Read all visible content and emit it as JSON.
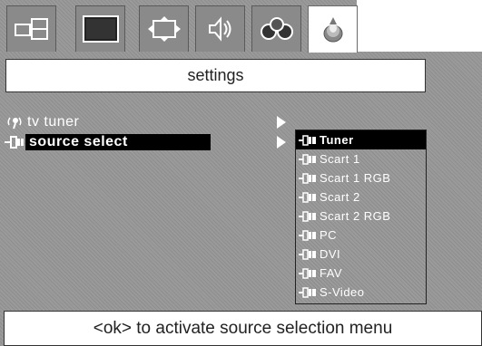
{
  "tabs": [
    {
      "name": "layout-tab",
      "icon": "picture-in-picture-icon"
    },
    {
      "name": "screen-tab",
      "icon": "screen-icon"
    },
    {
      "name": "image-format-tab",
      "icon": "image-format-icon"
    },
    {
      "name": "sound-tab",
      "icon": "speaker-icon"
    },
    {
      "name": "features-tab",
      "icon": "features-icon"
    },
    {
      "name": "settings-tab",
      "icon": "settings-icon",
      "active": true
    }
  ],
  "title": "settings",
  "menu": {
    "items": [
      {
        "label": "tv tuner",
        "icon": "antenna-icon",
        "selected": false
      },
      {
        "label": "source select",
        "icon": "source-plug-icon",
        "selected": true
      }
    ]
  },
  "submenu": {
    "items": [
      {
        "label": "Tuner",
        "selected": true
      },
      {
        "label": "Scart 1"
      },
      {
        "label": "Scart 1 RGB"
      },
      {
        "label": "Scart 2"
      },
      {
        "label": "Scart 2 RGB"
      },
      {
        "label": "PC"
      },
      {
        "label": "DVI"
      },
      {
        "label": "FAV"
      },
      {
        "label": "S-Video"
      }
    ]
  },
  "help": "<ok> to activate source selection menu",
  "colors": {
    "frame": "#9a9a9a",
    "selected": "#000000",
    "panel": "#ffffff"
  }
}
